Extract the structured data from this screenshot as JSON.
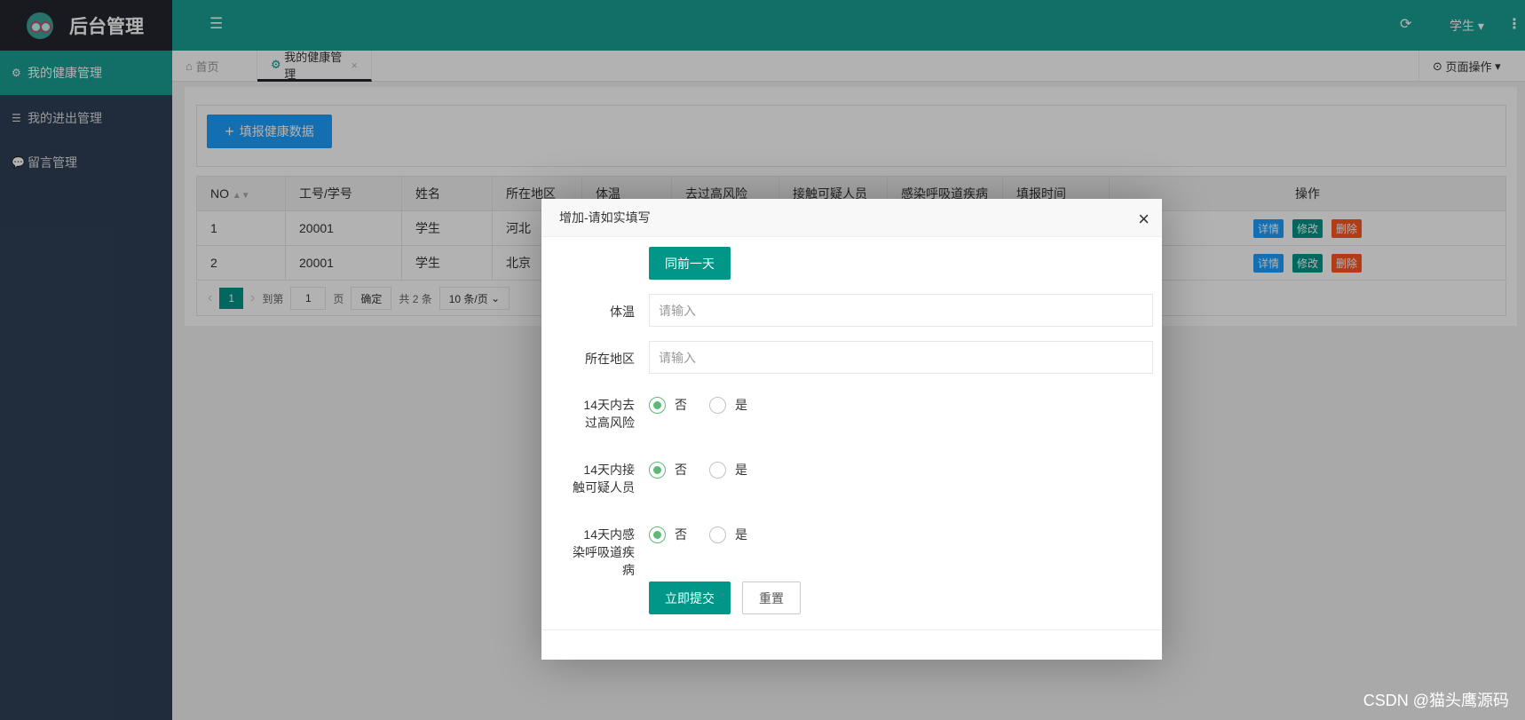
{
  "app": {
    "title": "后台管理",
    "user": "学生"
  },
  "sidebar": {
    "items": [
      {
        "label": "我的健康管理",
        "icon": "gears-icon"
      },
      {
        "label": "我的进出管理",
        "icon": "list-icon"
      },
      {
        "label": "留言管理",
        "icon": "comments-icon"
      }
    ]
  },
  "tabs": {
    "home": "首页",
    "active": "我的健康管理",
    "page_ops": "页面操作"
  },
  "toolbar": {
    "add_label": "填报健康数据"
  },
  "table": {
    "headers": [
      "NO",
      "工号/学号",
      "姓名",
      "所在地区",
      "体温",
      "去过高风险",
      "接触可疑人员",
      "感染呼吸道疾病",
      "填报时间",
      "操作"
    ],
    "rows": [
      [
        "1",
        "20001",
        "学生",
        "河北"
      ],
      [
        "2",
        "20001",
        "学生",
        "北京"
      ]
    ],
    "actions": {
      "detail": "详情",
      "edit": "修改",
      "delete": "删除"
    }
  },
  "pager": {
    "current": "1",
    "goto": "到第",
    "page_value": "1",
    "page_unit": "页",
    "confirm": "确定",
    "total": "共 2 条",
    "page_size": "10 条/页"
  },
  "modal": {
    "title": "增加-请如实填写",
    "same_as_yesterday": "同前一天",
    "temp_label": "体温",
    "temp_placeholder": "请输入",
    "region_label": "所在地区",
    "region_placeholder": "请输入",
    "q1_label": "14天内去过高风险",
    "q2_label": "14天内接触可疑人员",
    "q3_label": "14天内感染呼吸道疾病",
    "no": "否",
    "yes": "是",
    "submit": "立即提交",
    "reset": "重置"
  },
  "watermark": "CSDN @猫头鹰源码",
  "colors": {
    "teal": "#1aa094",
    "green": "#009688",
    "blue": "#1E9FFF",
    "orange": "#FF5722",
    "sidebar": "#2f4056"
  }
}
